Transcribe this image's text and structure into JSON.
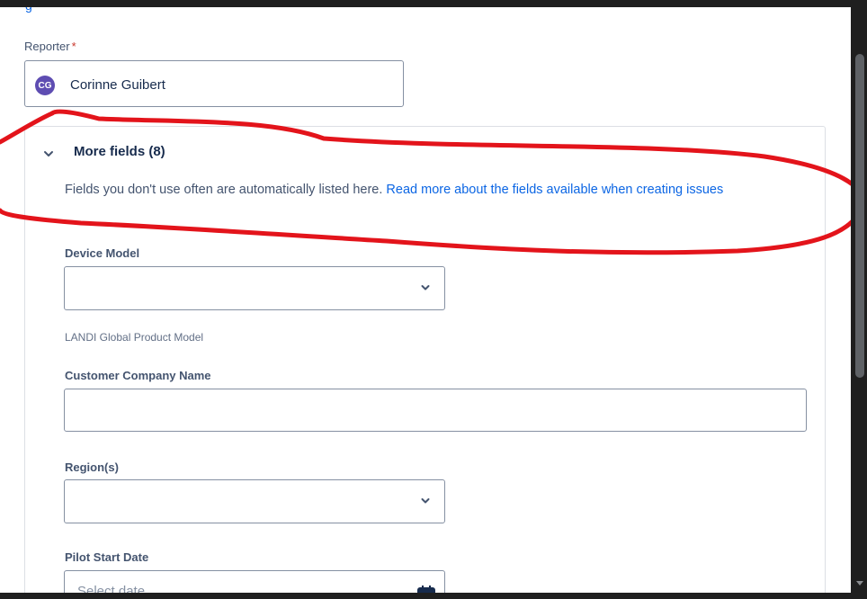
{
  "top_link": "g",
  "reporter": {
    "label": "Reporter",
    "required_mark": "*",
    "avatar_initials": "CG",
    "name": "Corinne Guibert"
  },
  "more_fields": {
    "title": "More fields (8)",
    "description": "Fields you don't use often are automatically listed here. ",
    "link_text": "Read more about the fields available when creating issues"
  },
  "fields": {
    "device_model": {
      "label": "Device Model",
      "value": "",
      "helper": "LANDI Global Product Model"
    },
    "customer_company": {
      "label": "Customer Company Name",
      "value": ""
    },
    "regions": {
      "label": "Region(s)",
      "value": ""
    },
    "pilot_start": {
      "label": "Pilot Start Date",
      "placeholder": "Select date"
    }
  },
  "colors": {
    "annotation_stroke": "#e3141b",
    "avatar": "#5e4db2",
    "link": "#0c66e4"
  }
}
